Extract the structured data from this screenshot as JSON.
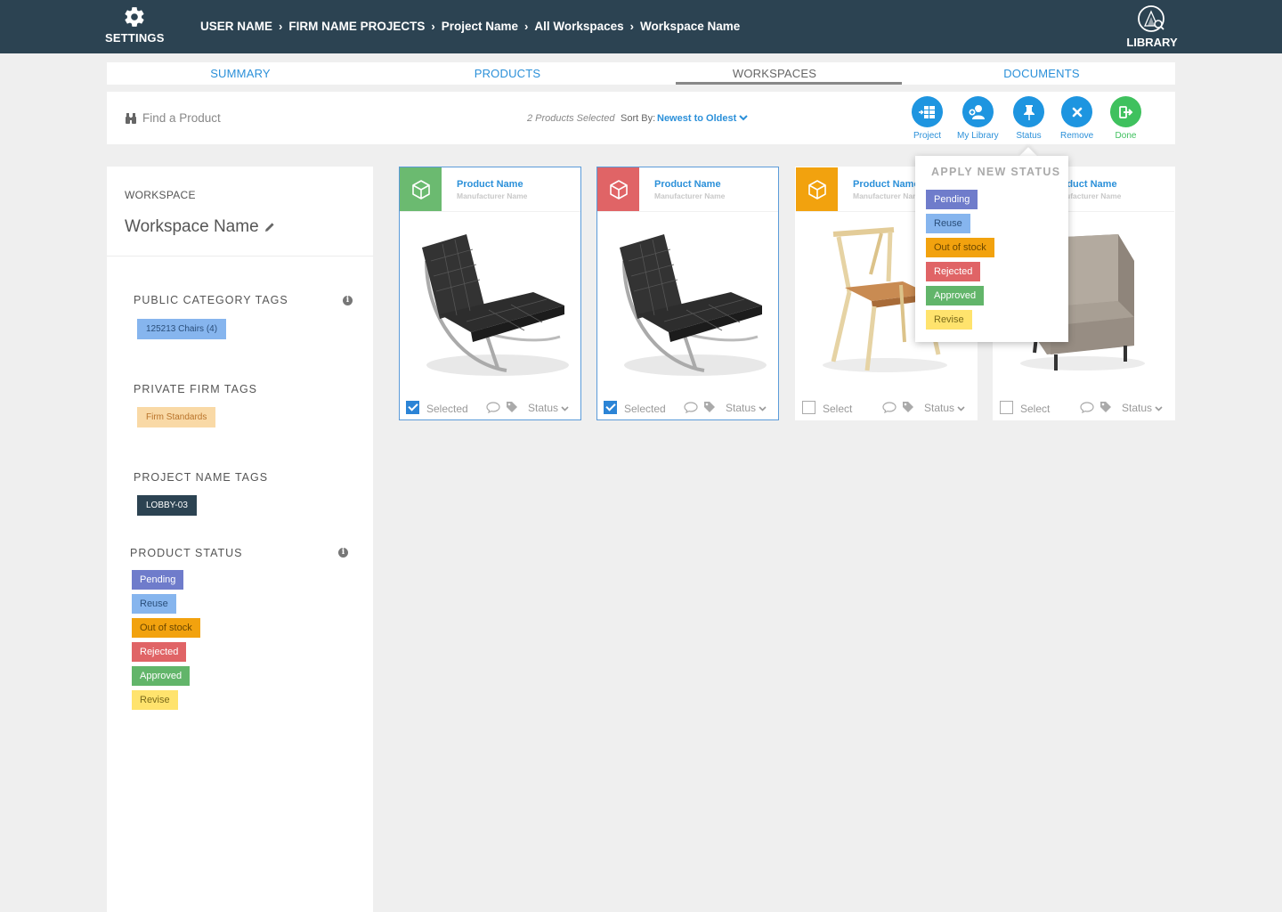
{
  "topbar": {
    "settings_label": "SETTINGS",
    "library_label": "LIBRARY",
    "breadcrumb": [
      "USER NAME",
      "FIRM NAME PROJECTS",
      "Project Name",
      "All Workspaces",
      "Workspace Name"
    ],
    "separator": "›",
    "bg_color": "#2c4352"
  },
  "tabs": [
    {
      "label": "SUMMARY",
      "active": false
    },
    {
      "label": "PRODUCTS",
      "active": false
    },
    {
      "label": "WORKSPACES",
      "active": true
    },
    {
      "label": "DOCUMENTS",
      "active": false
    }
  ],
  "toolbar": {
    "search_placeholder": "Find a Product",
    "selected_info": "2 Products Selected",
    "sort_label": "Sort By:",
    "sort_value": "Newest to Oldest",
    "actions": [
      {
        "label": "Project",
        "icon": "add-to-project-icon"
      },
      {
        "label": "My Library",
        "icon": "add-user-icon"
      },
      {
        "label": "Status",
        "icon": "pin-icon"
      },
      {
        "label": "Remove",
        "icon": "close-icon"
      },
      {
        "label": "Done",
        "icon": "exit-icon"
      }
    ]
  },
  "sidebar": {
    "workspace_caption": "WORKSPACE",
    "workspace_name": "Workspace Name",
    "public_tags_heading": "PUBLIC CATEGORY TAGS",
    "public_tags": [
      "125213 Chairs (4)"
    ],
    "private_tags_heading": "PRIVATE FIRM TAGS",
    "private_tags": [
      "Firm Standards"
    ],
    "project_tags_heading": "PROJECT NAME TAGS",
    "project_tags": [
      "LOBBY-03"
    ],
    "status_heading": "PRODUCT STATUS",
    "statuses": [
      "Pending",
      "Reuse",
      "Out of stock",
      "Rejected",
      "Approved",
      "Revise"
    ]
  },
  "cards": [
    {
      "name": "Product Name",
      "manufacturer": "Manufacturer Name",
      "selected": true,
      "select_label": "Selected",
      "status_label": "Status",
      "accent": "#6bba70",
      "image": "barcelona-chair-icon"
    },
    {
      "name": "Product Name",
      "manufacturer": "Manufacturer Name",
      "selected": true,
      "select_label": "Selected",
      "status_label": "Status",
      "accent": "#e06466",
      "image": "barcelona-chair-icon"
    },
    {
      "name": "Product Name",
      "manufacturer": "Manufacturer Name",
      "selected": false,
      "select_label": "Select",
      "status_label": "Status",
      "accent": "#f2a20e",
      "image": "wooden-side-chair-icon"
    },
    {
      "name": "Product Name",
      "manufacturer": "Manufacturer Name",
      "selected": false,
      "select_label": "Select",
      "status_label": "Status",
      "accent": "#86b5ee",
      "image": "lounge-armchair-icon"
    }
  ],
  "status_popover": {
    "title": "APPLY NEW STATUS",
    "options": [
      "Pending",
      "Reuse",
      "Out of stock",
      "Rejected",
      "Approved",
      "Revise"
    ]
  },
  "colors": {
    "accent_blue": "#2b90d9",
    "done_green": "#3fc15e",
    "pending": "#6f7ccb",
    "reuse": "#86b5ee",
    "out_of_stock": "#f2a20e",
    "rejected": "#e06466",
    "approved": "#62b56a",
    "revise": "#ffe36d"
  }
}
